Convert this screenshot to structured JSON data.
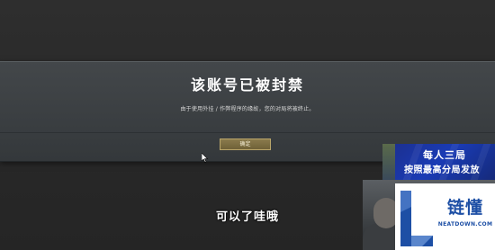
{
  "dialog": {
    "title": "该账号已被封禁",
    "message": "由于使用外挂 / 作弊程序的缘故，您的对局将被终止。",
    "confirm_label": "确定"
  },
  "subtitle": "可以了哇哦",
  "promo": {
    "line1": "每人三局",
    "line2": "按照最高分局发放"
  },
  "watermark": {
    "name": "链懂",
    "domain": "NEATDOWN.COM"
  },
  "colors": {
    "button_gold": "#8a7a4c",
    "promo_blue": "#1a3bb5",
    "brand_blue": "#1d4fa5"
  },
  "icons": [
    "mouse-cursor-icon",
    "watermark-logo-icon"
  ]
}
